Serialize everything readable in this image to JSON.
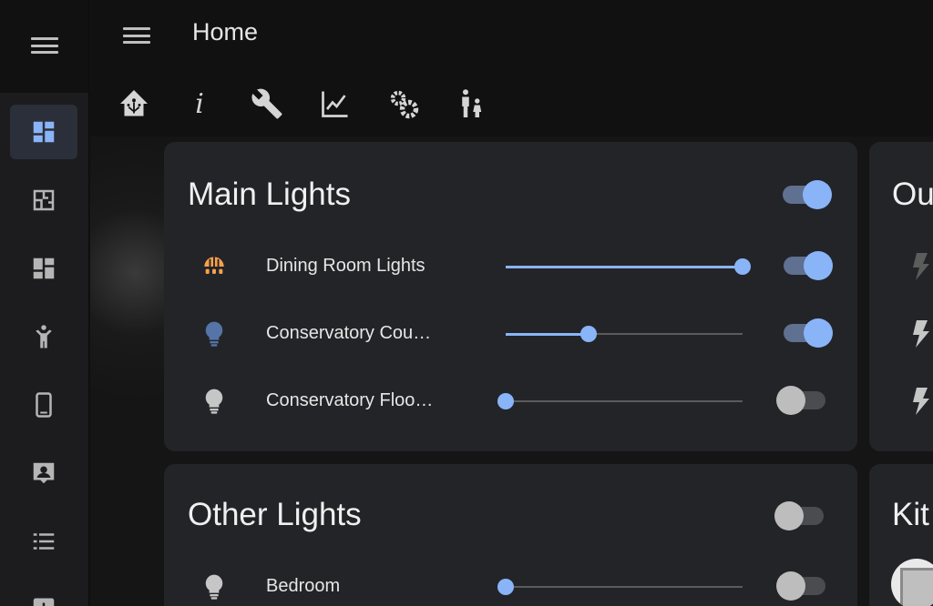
{
  "header": {
    "title": "Home",
    "tabs": [
      {
        "icon": "home-assistant-icon"
      },
      {
        "icon": "info-icon",
        "label": "i"
      },
      {
        "icon": "wrench-icon"
      },
      {
        "icon": "chart-line-icon"
      },
      {
        "icon": "cogs-icon"
      },
      {
        "icon": "human-male-girl-icon"
      }
    ]
  },
  "sidebar": {
    "items": [
      {
        "icon": "view-dashboard-icon",
        "active": true
      },
      {
        "icon": "floor-plan-icon"
      },
      {
        "icon": "view-dashboard-outline-icon"
      },
      {
        "icon": "human-handsup-icon"
      },
      {
        "icon": "cellphone-icon"
      },
      {
        "icon": "account-box-icon"
      },
      {
        "icon": "format-list-bulleted-icon"
      },
      {
        "icon": "chart-bar-icon"
      }
    ]
  },
  "cards": {
    "main_lights": {
      "title": "Main Lights",
      "master_on": true,
      "rows": [
        {
          "name": "Dining Room Lights",
          "icon": "ceiling-light-icon",
          "icon_color": "#f6a04d",
          "level": 1.0,
          "on": true
        },
        {
          "name": "Conservatory Cou…",
          "icon": "lightbulb-icon",
          "icon_color": "#5574a8",
          "level": 0.35,
          "on": true
        },
        {
          "name": "Conservatory Floo…",
          "icon": "lightbulb-icon",
          "icon_color": "#c6c6c6",
          "level": 0.0,
          "on": false
        }
      ]
    },
    "other_lights": {
      "title": "Other Lights",
      "master_on": false,
      "rows": [
        {
          "name": "Bedroom",
          "icon": "lightbulb-icon",
          "icon_color": "#c6c6c6",
          "level": 0.0,
          "on": false
        }
      ]
    },
    "right_top": {
      "title": "Ou"
    },
    "right_bottom": {
      "title": "Kit"
    }
  },
  "colors": {
    "accent": "#8ab4f8",
    "card_bg": "#232428",
    "sidebar_bg": "#1c1c1e"
  }
}
